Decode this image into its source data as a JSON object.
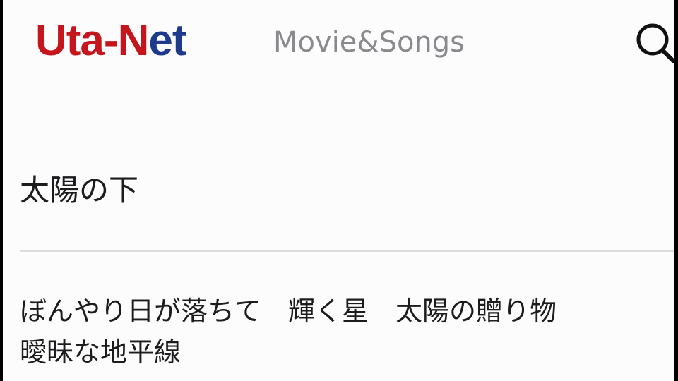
{
  "header": {
    "logo_part1": "Uta-",
    "logo_part2": "N",
    "logo_part3": "et",
    "nav_link": "Movie&Songs",
    "search_icon": "search-icon",
    "logo_colors": {
      "red": "#c4161c",
      "blue": "#1d3a8c"
    }
  },
  "song": {
    "title": "太陽の下",
    "lyrics": [
      "ぼんやり日が落ちて　輝く星　太陽の贈り物",
      "曖昧な地平線"
    ]
  }
}
